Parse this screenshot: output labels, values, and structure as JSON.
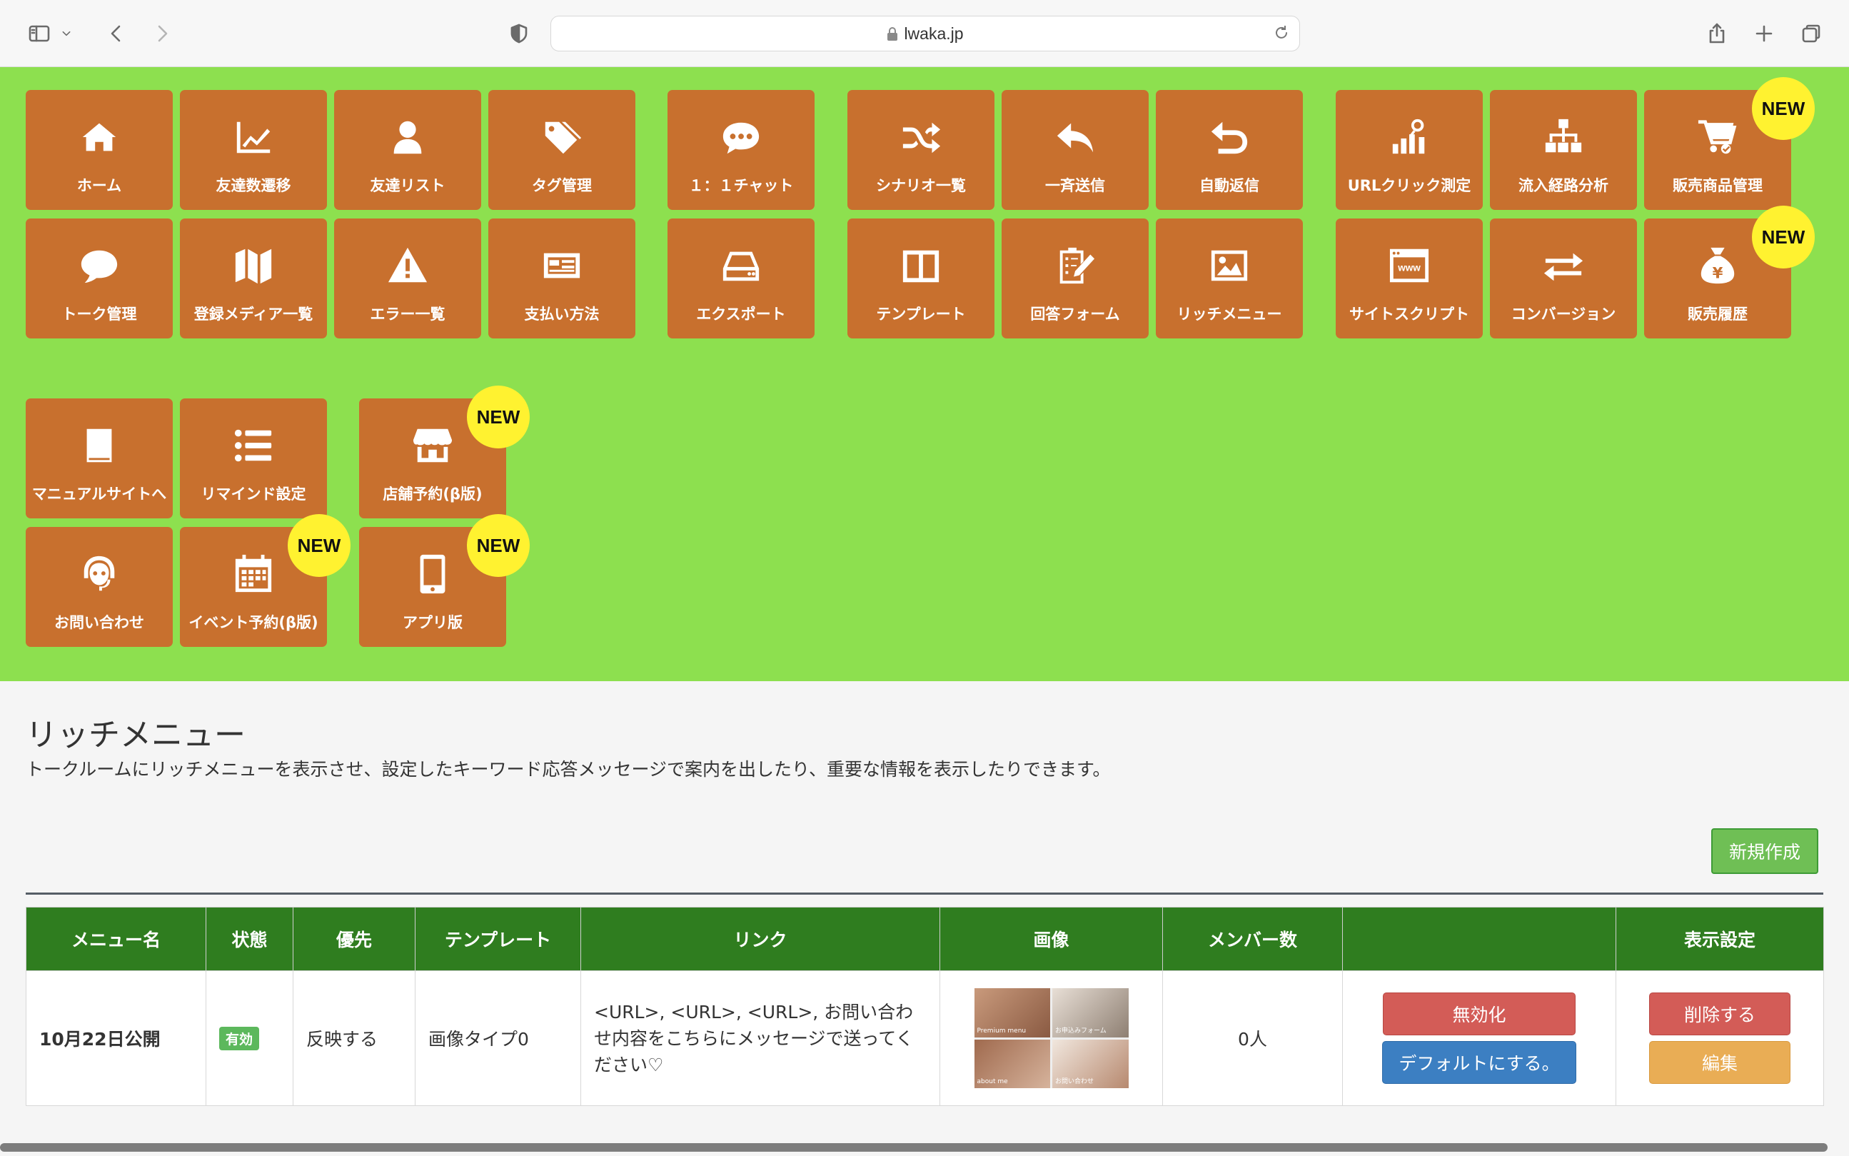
{
  "browser": {
    "url_host": "lwaka.jp"
  },
  "menu": {
    "new_badge": "NEW",
    "tiles": [
      {
        "label": "ホーム",
        "icon": "home-icon"
      },
      {
        "label": "友達数遷移",
        "icon": "line-chart-icon"
      },
      {
        "label": "友達リスト",
        "icon": "user-icon"
      },
      {
        "label": "タグ管理",
        "icon": "tags-icon"
      },
      {
        "label": "１：１チャット",
        "icon": "chat-icon"
      },
      {
        "label": "シナリオ一覧",
        "icon": "shuffle-icon"
      },
      {
        "label": "一斉送信",
        "icon": "reply-icon"
      },
      {
        "label": "自動返信",
        "icon": "undo-icon"
      },
      {
        "label": "URLクリック測定",
        "icon": "bar-search-icon"
      },
      {
        "label": "流入経路分析",
        "icon": "sitemap-icon"
      },
      {
        "label": "販売商品管理",
        "icon": "cart-icon"
      },
      {
        "label": "トーク管理",
        "icon": "speech-bubble-icon"
      },
      {
        "label": "登録メディア一覧",
        "icon": "map-icon"
      },
      {
        "label": "エラー一覧",
        "icon": "warning-icon"
      },
      {
        "label": "支払い方法",
        "icon": "credit-card-icon"
      },
      {
        "label": "エクスポート",
        "icon": "drive-icon"
      },
      {
        "label": "テンプレート",
        "icon": "columns-icon"
      },
      {
        "label": "回答フォーム",
        "icon": "clipboard-icon"
      },
      {
        "label": "リッチメニュー",
        "icon": "image-icon"
      },
      {
        "label": "サイトスクリプト",
        "icon": "www-icon"
      },
      {
        "label": "コンバージョン",
        "icon": "exchange-icon"
      },
      {
        "label": "販売履歴",
        "icon": "money-bag-icon"
      },
      {
        "label": "マニュアルサイトへ",
        "icon": "book-icon"
      },
      {
        "label": "リマインド設定",
        "icon": "list-icon"
      },
      {
        "label": "店舗予約(β版)",
        "icon": "store-icon"
      },
      {
        "label": "お問い合わせ",
        "icon": "headset-icon"
      },
      {
        "label": "イベント予約(β版)",
        "icon": "calendar-icon"
      },
      {
        "label": "アプリ版",
        "icon": "mobile-icon"
      }
    ]
  },
  "page": {
    "title": "リッチメニュー",
    "description": "トークルームにリッチメニューを表示させ、設定したキーワード応答メッセージで案内を出したり、重要な情報を表示したりできます。",
    "new_button": "新規作成"
  },
  "table": {
    "headers": [
      "メニュー名",
      "状態",
      "優先",
      "テンプレート",
      "リンク",
      "画像",
      "メンバー数",
      "",
      "表示設定"
    ],
    "rows": [
      {
        "name": "10月22日公開",
        "status": "有効",
        "priority": "反映する",
        "template": "画像タイプ0",
        "link": "<URL>, <URL>, <URL>, お問い合わせ内容をこちらにメッセージで送ってください♡",
        "thumb_labels": [
          "Premium menu",
          "お申込みフォーム",
          "about me",
          "お問い合わせ"
        ],
        "members": "0人",
        "disable_button": "無効化",
        "default_button": "デフォルトにする。",
        "delete_button": "削除する",
        "edit_button": "編集"
      }
    ]
  },
  "colors": {
    "menu_bg": "#8de04f",
    "tile": "#c8702e",
    "header_green": "#2f7d1f",
    "new_badge": "#fff230"
  }
}
